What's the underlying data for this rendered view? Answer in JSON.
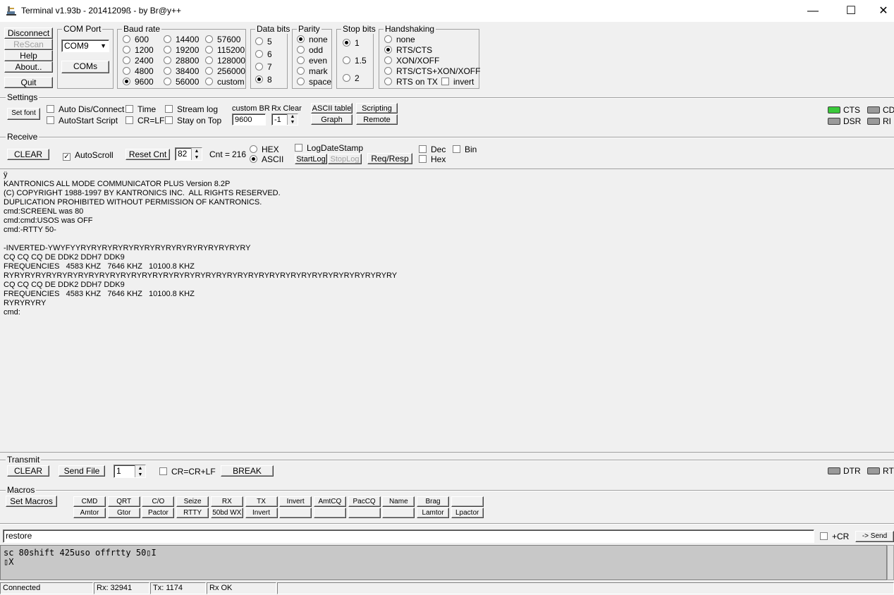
{
  "window": {
    "title": "Terminal v1.93b - 20141209ß - by Br@y++",
    "minimize_glyph": "—",
    "maximize_glyph": "☐",
    "close_glyph": "✕",
    "app_icon": "terminal-app-icon"
  },
  "conn_buttons": {
    "disconnect": "Disconnect",
    "rescan": "ReScan",
    "help": "Help",
    "about": "About..",
    "quit": "Quit"
  },
  "com_port": {
    "label": "COM Port",
    "value": "COM9",
    "coms_button": "COMs"
  },
  "baud": {
    "label": "Baud rate",
    "options": [
      "600",
      "1200",
      "2400",
      "4800",
      "9600",
      "14400",
      "19200",
      "28800",
      "38400",
      "56000",
      "57600",
      "115200",
      "128000",
      "256000",
      "custom"
    ],
    "selected": "9600"
  },
  "data_bits": {
    "label": "Data bits",
    "options": [
      "5",
      "6",
      "7",
      "8"
    ],
    "selected": "8"
  },
  "parity": {
    "label": "Parity",
    "options": [
      "none",
      "odd",
      "even",
      "mark",
      "space"
    ],
    "selected": "none"
  },
  "stop_bits": {
    "label": "Stop bits",
    "options": [
      "1",
      "1.5",
      "2"
    ],
    "selected": "1"
  },
  "handshaking": {
    "label": "Handshaking",
    "options": [
      "none",
      "RTS/CTS",
      "XON/XOFF",
      "RTS/CTS+XON/XOFF",
      "RTS on TX"
    ],
    "selected": "RTS/CTS",
    "invert_label": "invert"
  },
  "settings": {
    "label": "Settings",
    "set_font": "Set font",
    "auto_dis_connect": "Auto Dis/Connect",
    "autostart_script": "AutoStart Script",
    "time": "Time",
    "cr_lf": "CR=LF",
    "stream_log": "Stream log",
    "stay_on_top": "Stay on Top",
    "custom_br_label": "custom BR",
    "custom_br_value": "9600",
    "rx_clear_label": "Rx Clear",
    "rx_clear_value": "-1",
    "ascii_table": "ASCII table",
    "scripting": "Scripting",
    "graph": "Graph",
    "remote": "Remote"
  },
  "leds": {
    "cts": "CTS",
    "cd": "CD",
    "dsr": "DSR",
    "ri": "RI",
    "dtr": "DTR",
    "rt": "RT"
  },
  "receive": {
    "label": "Receive",
    "clear": "CLEAR",
    "autoscroll": "AutoScroll",
    "reset_cnt": "Reset Cnt",
    "cnt_value": "82",
    "cnt_label": "Cnt =",
    "cnt": "216",
    "hex": "HEX",
    "ascii": "ASCII",
    "log_date_stamp": "LogDateStamp",
    "start_log": "StartLog",
    "stop_log": "StopLog",
    "req_resp": "Req/Resp",
    "dec": "Dec",
    "hex_cb": "Hex",
    "bin": "Bin",
    "text": "ÿ\nKANTRONICS ALL MODE COMMUNICATOR PLUS Version 8.2P\n(C) COPYRIGHT 1988-1997 BY KANTRONICS INC.  ALL RIGHTS RESERVED.\nDUPLICATION PROHIBITED WITHOUT PERMISSION OF KANTRONICS.\ncmd:SCREENL was 80\ncmd:cmd:USOS was OFF\ncmd:-RTTY 50-\n\n-INVERTED-YWYFYYRYRYRYRYRYRYRYRYRYRYRYRYRYRYRYRY\nCQ CQ CQ DE DDK2 DDH7 DDK9\nFREQUENCIES   4583 KHZ   7646 KHZ   10100.8 KHZ\nRYRYRYRYRYRYRYRYRYRYRYRYRYRYRYRYRYRYRYRYRYRYRYRYRYRYRYRYRYRYRYRYRYRYRYRYRY\nCQ CQ CQ DE DDK2 DDH7 DDK9\nFREQUENCIES   4583 KHZ   7646 KHZ   10100.8 KHZ\nRYRYRYRY\ncmd:"
  },
  "transmit": {
    "label": "Transmit",
    "clear": "CLEAR",
    "send_file": "Send File",
    "count": "1",
    "cr_crlf": "CR=CR+LF",
    "break": "BREAK"
  },
  "macros": {
    "label": "Macros",
    "set_macros": "Set Macros",
    "row1": [
      "CMD",
      "QRT",
      "C/O",
      "Seize",
      "RX",
      "TX",
      "Invert",
      "AmtCQ",
      "PacCQ",
      "Name",
      "Brag",
      ""
    ],
    "row2": [
      "Amtor",
      "Gtor",
      "Pactor",
      "RTTY",
      "50bd WX",
      "Invert",
      "",
      "",
      "",
      "",
      "Lamtor",
      "Lpactor"
    ]
  },
  "send": {
    "input_value": "restore",
    "plus_cr": "+CR",
    "send_button": "-> Send"
  },
  "tx_log": "sc 80shift 425uso offrtty 50▯I\n▯X",
  "status": {
    "connection": "Connected",
    "rx": "Rx: 32941",
    "tx": "Tx: 1174",
    "rx_status": "Rx OK"
  }
}
